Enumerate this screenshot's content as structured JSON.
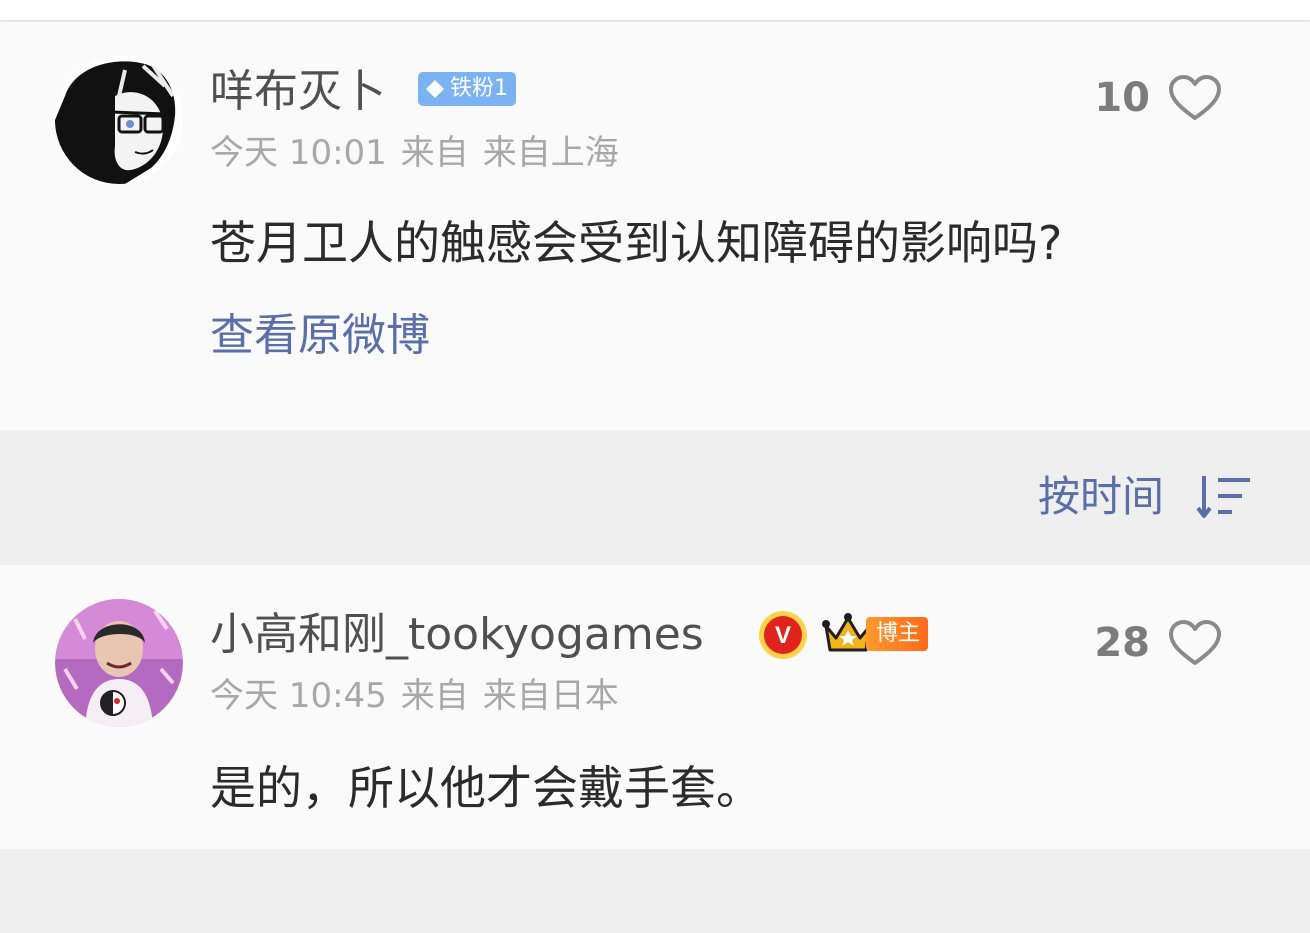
{
  "comment_op": {
    "username": "咩布灭卜",
    "fan_badge": "铁粉1",
    "time": "今天 10:01",
    "from_label": "来自",
    "location": "来自上海",
    "content": "苍月卫人的触感会受到认知障碍的影响吗?",
    "view_original": "查看原微博",
    "likes": "10"
  },
  "sort": {
    "label": "按时间"
  },
  "comment_reply": {
    "username": "小高和刚_tookyogames",
    "verified_letter": "V",
    "blogger_badge": "博主",
    "time": "今天 10:45",
    "from_label": "来自",
    "location": "来自日本",
    "content": "是的，所以他才会戴手套。",
    "likes": "28"
  },
  "colors": {
    "link": "#5a6fa8",
    "fan_badge": "#7ab2f2",
    "verified": "#e0231d",
    "blogger_badge": "#ff7a1f"
  },
  "icons": {
    "like": "heart-outline-icon",
    "sort": "sort-descending-icon",
    "verified": "verified-v-icon",
    "crown": "crown-icon",
    "fan": "diamond-icon"
  }
}
